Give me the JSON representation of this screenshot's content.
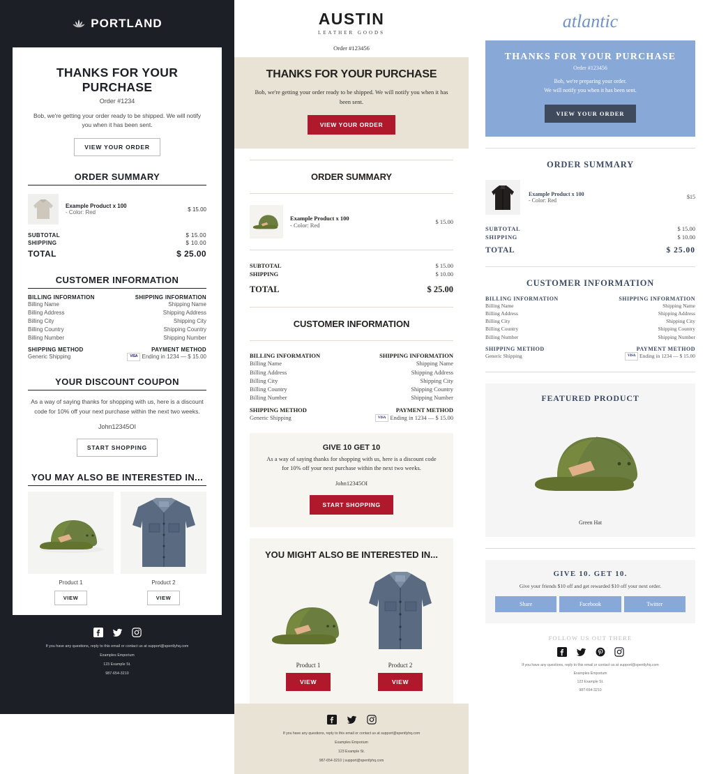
{
  "panel1": {
    "brand": "PORTLAND",
    "logo_icon": "lotus-icon",
    "headline": "THANKS FOR YOUR PURCHASE",
    "order_number": "Order #1234",
    "intro": "Bob, we're getting your order ready to be shipped. We will notify you when it has been sent.",
    "cta": "VIEW YOUR ORDER",
    "order_summary_title": "ORDER SUMMARY",
    "item": {
      "name": "Example Product x 100",
      "variant": "- Color: Red",
      "price": "$ 15.00",
      "thumb": "grey-sweater"
    },
    "totals": [
      {
        "label": "SUBTOTAL",
        "amount": "$ 15.00"
      },
      {
        "label": "SHIPPING",
        "amount": "$ 10.00"
      }
    ],
    "total": {
      "label": "TOTAL",
      "amount": "$ 25.00"
    },
    "customer_title": "CUSTOMER INFORMATION",
    "billing_heading": "BILLING INFORMATION",
    "billing_lines": [
      "Billing Name",
      "Billing Address",
      "Billing City",
      "Billing Country",
      "Billing Number"
    ],
    "shipping_heading": "SHIPPING INFORMATION",
    "shipping_lines": [
      "Shipping Name",
      "Shipping Address",
      "Shipping City",
      "Shipping Country",
      "Shipping Number"
    ],
    "shipping_method_heading": "SHIPPING METHOD",
    "shipping_method_value": "Generic Shipping",
    "payment_method_heading": "PAYMENT METHOD",
    "card_brand": "VISA",
    "payment_value": "Ending in 1234 — $ 15.00",
    "coupon_title": "YOUR DISCOUNT COUPON",
    "coupon_text": "As a way of saying thanks for shopping with us, here is a discount code for 10% off your next purchase within the next two weeks.",
    "coupon_code": "John12345OI",
    "coupon_cta": "START SHOPPING",
    "recommend_title": "YOU MAY ALSO BE INTERESTED IN...",
    "products": [
      {
        "name": "Product 1",
        "cta": "VIEW",
        "image": "green-hat"
      },
      {
        "name": "Product 2",
        "cta": "VIEW",
        "image": "blue-shirt"
      }
    ],
    "social": [
      "facebook-icon",
      "twitter-icon",
      "instagram-icon"
    ],
    "footer_lines": [
      "If you have any questions, reply to this email or contact us at support@spentlyhq.com",
      "Examples Emporium",
      "123 Example St.",
      "987-654-3210"
    ]
  },
  "panel2": {
    "brand": "AUSTIN",
    "brand_sub": "LEATHER GOODS",
    "order_number": "Order #123456",
    "headline": "THANKS FOR YOUR PURCHASE",
    "intro": "Bob, we're getting your order ready to be shipped. We will notify you when it has been sent.",
    "cta": "VIEW YOUR ORDER",
    "order_summary_title": "ORDER SUMMARY",
    "item": {
      "name": "Example Product x 100",
      "variant": "- Color: Red",
      "price": "$ 15.00",
      "thumb": "green-hat"
    },
    "totals": [
      {
        "label": "SUBTOTAL",
        "amount": "$ 15.00"
      },
      {
        "label": "SHIPPING",
        "amount": "$ 10.00"
      }
    ],
    "total": {
      "label": "TOTAL",
      "amount": "$ 25.00"
    },
    "customer_title": "CUSTOMER INFORMATION",
    "billing_heading": "BILLING INFORMATION",
    "billing_lines": [
      "Billing Name",
      "Billing Address",
      "Billing City",
      "Billing Country",
      "Billing Number"
    ],
    "shipping_heading": "SHIPPING INFORMATION",
    "shipping_lines": [
      "Shipping Name",
      "Shipping Address",
      "Shipping City",
      "Shipping Country",
      "Shipping Number"
    ],
    "shipping_method_heading": "SHIPPING METHOD",
    "shipping_method_value": "Generic Shipping",
    "payment_method_heading": "PAYMENT METHOD",
    "card_brand": "VISA",
    "payment_value": "Ending in 1234 — $ 15.00",
    "promo_title": "GIVE 10 GET 10",
    "promo_text": "As a way of saying thanks for shopping with us, here is a discount code for 10% off your next purchase within the next two weeks.",
    "promo_code": "John12345OI",
    "promo_cta": "START SHOPPING",
    "recommend_title": "YOU MIGHT ALSO BE INTERESTED IN...",
    "products": [
      {
        "name": "Product 1",
        "cta": "VIEW",
        "image": "green-hat"
      },
      {
        "name": "Product 2",
        "cta": "VIEW",
        "image": "blue-shirt"
      }
    ],
    "social": [
      "facebook-icon",
      "twitter-icon",
      "instagram-icon"
    ],
    "footer_lines": [
      "If you have any questions, reply to this email or contact us at support@spentlyhq.com",
      "Examples Emporium",
      "123 Example St.",
      "987-654-3210 | support@spentlyhq.com"
    ],
    "accent_color": "#b0192c",
    "hero_color": "#e9e3d5"
  },
  "panel3": {
    "brand": "atlantic",
    "headline": "THANKS FOR YOUR PURCHASE",
    "order_number": "Order #123456",
    "intro_line1": "Bob, we're preparing your order.",
    "intro_line2": "We will notify you when it has been sent.",
    "cta": "VIEW YOUR ORDER",
    "order_summary_title": "ORDER SUMMARY",
    "item": {
      "name": "Example Product x 100",
      "variant": "- Color: Red",
      "price": "$15",
      "thumb": "dark-cardigan"
    },
    "totals": [
      {
        "label": "SUBTOTAL",
        "amount": "$ 15.00"
      },
      {
        "label": "SHIPPING",
        "amount": "$ 10.00"
      }
    ],
    "total": {
      "label": "TOTAL",
      "amount": "$ 25.00"
    },
    "customer_title": "CUSTOMER INFORMATION",
    "billing_heading": "BILLING INFORMATION",
    "billing_lines": [
      "Billing Name",
      "Billing Address",
      "Billing City",
      "Billing Country",
      "Billing Number"
    ],
    "shipping_heading": "SHIPPING INFORMATION",
    "shipping_lines": [
      "Shipping Name",
      "Shipping Address",
      "Shipping City",
      "Shipping Country",
      "Shipping Number"
    ],
    "shipping_method_heading": "SHIPPING METHOD",
    "shipping_method_value": "Generic Shipping",
    "payment_method_heading": "PAYMENT METHOD",
    "card_brand": "VISA",
    "payment_value": "Ending in 1234 — $ 15.00",
    "featured_title": "FEATURED PRODUCT",
    "featured_name": "Green Hat",
    "give_title": "GIVE 10. GET 10.",
    "give_text": "Give your friends $10 off and get rewarded $10 off your next order.",
    "share_buttons": [
      "Share",
      "Facebook",
      "Twitter"
    ],
    "follow_title": "FOLLOW US OUT THERE",
    "social": [
      "facebook-icon",
      "twitter-icon",
      "pinterest-icon",
      "instagram-icon"
    ],
    "footer_lines": [
      "If you have any questions, reply to this email or contact us at support@spentlyhq.com",
      "Examples Emporium",
      "123 Example St.",
      "987-654-3210"
    ],
    "hero_color": "#88a9d8",
    "button_color": "#3f4a5c"
  }
}
